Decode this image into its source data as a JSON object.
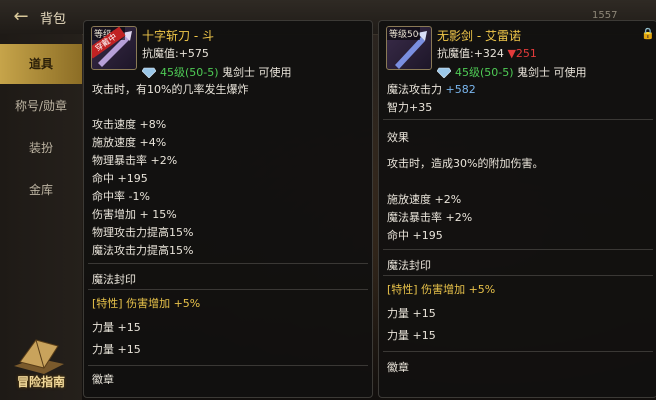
{
  "header": {
    "title": "背包",
    "values": [
      "1557"
    ]
  },
  "sidenav": {
    "items": [
      {
        "label": "道具",
        "active": true
      },
      {
        "label": "称号/勋章",
        "active": false
      },
      {
        "label": "装扮",
        "active": false
      },
      {
        "label": "金库",
        "active": false
      }
    ],
    "logo_text": "冒险指南"
  },
  "left_item": {
    "icon_level": "等级30",
    "ribbon": "穿戴中",
    "name": "十字斩刀 - 斗",
    "resist_label": "抗魔值:",
    "resist_value": "+575",
    "req_level": "45级(50-5)",
    "req_class": "鬼剑士 可使用",
    "desc": "攻击时，有10%的几率发生爆炸",
    "stats": [
      "攻击速度 +8%",
      "施放速度 +4%",
      "物理暴击率 +2%",
      "命中 +195",
      "命中率 -1%",
      "伤害增加 + 15%",
      "物理攻击力提高15%",
      "魔法攻击力提高15%"
    ],
    "seal_title": "魔法封印",
    "trait": "[特性] 伤害增加 +5%",
    "seal_stats": [
      "力量 +15",
      "力量 +15"
    ],
    "emblem_title": "徽章"
  },
  "right_item": {
    "icon_level": "等级50",
    "name": "无影剑 - 艾雷诺",
    "resist_label": "抗魔值:",
    "resist_plus": "+324",
    "resist_down": "▼251",
    "req_level": "45级(50-5)",
    "req_class": "鬼剑士 可使用",
    "magic_atk_label": "魔法攻击力",
    "magic_atk_value": "+582",
    "intel": "智力+35",
    "effect_title": "效果",
    "effect_desc": "攻击时，造成30%的附加伤害。",
    "stats": [
      "施放速度 +2%",
      "魔法暴击率 +2%",
      "命中 +195"
    ],
    "seal_title": "魔法封印",
    "trait": "[特性] 伤害增加 +5%",
    "seal_stats": [
      "力量 +15",
      "力量 +15"
    ],
    "emblem_title": "徽章"
  }
}
